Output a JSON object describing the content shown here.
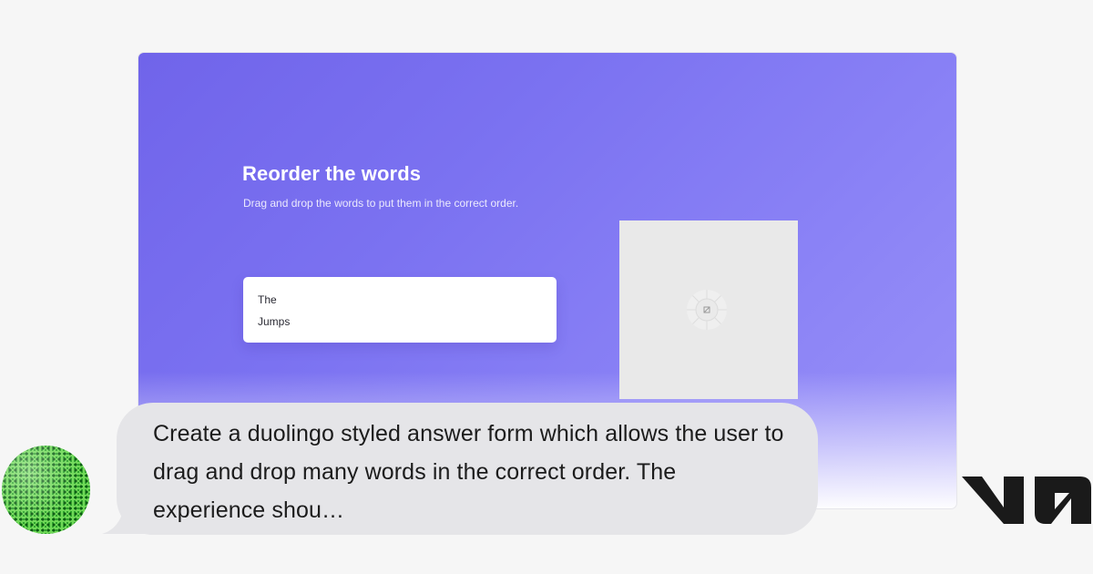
{
  "preview": {
    "title": "Reorder the words",
    "subtitle": "Drag and drop the words to put them in the correct order.",
    "words": [
      "The",
      "Jumps"
    ]
  },
  "chat": {
    "message": "Create a duolingo styled answer form which allows the user to drag and drop many words in the correct order. The experience shou…"
  },
  "colors": {
    "accent": "#7064ea",
    "avatar_green": "#6fd857"
  },
  "icons": {
    "avatar": "avatar-icon",
    "image_placeholder": "image-placeholder-icon",
    "brand_logo": "v0-logo-icon"
  }
}
